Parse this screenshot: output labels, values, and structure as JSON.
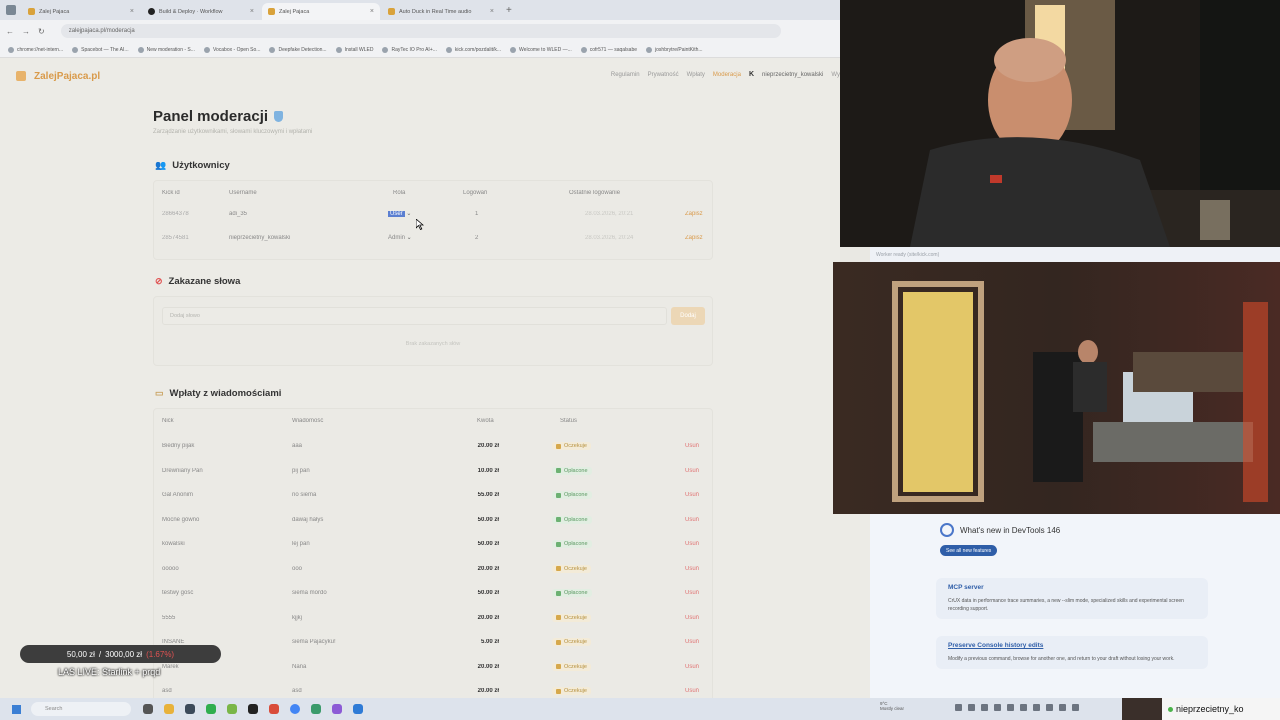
{
  "browser": {
    "tabs": [
      {
        "label": "Zalej Pajaca",
        "active": false
      },
      {
        "label": "Build & Deploy · Workflow",
        "active": false
      },
      {
        "label": "Zalej Pajaca",
        "active": true
      },
      {
        "label": "Auto Duck in Real Time audio",
        "active": false
      }
    ],
    "new_tab": "+",
    "url": "zalejpajaca.pl/moderacja",
    "bookmarks": [
      "chrome://net-intern...",
      "Spacebot — The AI...",
      "New moderation - S...",
      "Vocabox - Open So...",
      "Deepfake Detection...",
      "Install WLED",
      "RayTec IO Pro AI+...",
      "kick.com/pozdalit/k...",
      "Welcome to WLED —...",
      "cofr571 — saqalsabe",
      "joshbrytre/PaintKith..."
    ]
  },
  "site": {
    "logo": "ZalejPajaca.pl",
    "nav": [
      "Regulamin",
      "Prywatność",
      "Wpłaty",
      "Moderacja"
    ],
    "kick_k": "K",
    "user": "nieprzecietny_kowalski",
    "more": "Wy"
  },
  "page": {
    "title": "Panel moderacji",
    "subtitle": "Zarządzanie użytkownikami, słowami kluczowymi i wpłatami"
  },
  "users": {
    "title": "Użytkownicy",
    "columns": [
      "Kick id",
      "Username",
      "Rola",
      "Logowań",
      "Ostatnie logowanie"
    ],
    "rows": [
      {
        "kick_id": "28664378",
        "username": "adi_35",
        "role": "User",
        "logins": "1",
        "last": "28.03.2026, 20:21",
        "save": "Zapisz"
      },
      {
        "kick_id": "28574581",
        "username": "nieprzecietny_kowalski",
        "role": "Admin",
        "logins": "2",
        "last": "28.03.2026, 20:24",
        "save": "Zapisz"
      }
    ]
  },
  "banned": {
    "title": "Zakazane słowa",
    "placeholder": "Dodaj słowo",
    "add": "Dodaj",
    "empty": "Brak zakazanych słów"
  },
  "payments": {
    "title": "Wpłaty z wiadomościami",
    "columns": [
      "Nick",
      "Wiadomość",
      "Kwota",
      "Status"
    ],
    "rows": [
      {
        "nick": "Biedny pijak",
        "msg": "aaa",
        "amount": "20.00 zł",
        "status": "Oczekuje",
        "kind": "pend",
        "del": "Usuń"
      },
      {
        "nick": "Drewniany Pan",
        "msg": "pij pan",
        "amount": "10.00 zł",
        "status": "Opłacone",
        "kind": "paid",
        "del": "Usuń"
      },
      {
        "nick": "Gal Anonim",
        "msg": "no siema",
        "amount": "55.00 zł",
        "status": "Opłacone",
        "kind": "paid",
        "del": "Usuń"
      },
      {
        "nick": "Mocne gówno",
        "msg": "dawaj hałys",
        "amount": "50.00 zł",
        "status": "Opłacone",
        "kind": "paid",
        "del": "Usuń"
      },
      {
        "nick": "kowalski",
        "msg": "lej pan",
        "amount": "50.00 zł",
        "status": "Opłacone",
        "kind": "paid",
        "del": "Usuń"
      },
      {
        "nick": "ooooo",
        "msg": "ooo",
        "amount": "20.00 zł",
        "status": "Oczekuje",
        "kind": "pend",
        "del": "Usuń"
      },
      {
        "nick": "testwy gość",
        "msg": "siema mordo",
        "amount": "50.00 zł",
        "status": "Opłacone",
        "kind": "paid",
        "del": "Usuń"
      },
      {
        "nick": "5555",
        "msg": "kjjkj",
        "amount": "20.00 zł",
        "status": "Oczekuje",
        "kind": "pend",
        "del": "Usuń"
      },
      {
        "nick": "INSANE",
        "msg": "siema Pajacyku!",
        "amount": "5.00 zł",
        "status": "Oczekuje",
        "kind": "pend",
        "del": "Usuń"
      },
      {
        "nick": "Marek",
        "msg": "Nana",
        "amount": "20.00 zł",
        "status": "Oczekuje",
        "kind": "pend",
        "del": "Usuń"
      },
      {
        "nick": "asd",
        "msg": "asd",
        "amount": "20.00 zł",
        "status": "Oczekuje",
        "kind": "pend",
        "del": "Usuń"
      }
    ]
  },
  "devtools": {
    "topbar": "Worker ready (site/kick.com)",
    "heading": "What's new in DevTools 146",
    "see_all": "See all new features",
    "cards": [
      {
        "title": "MCP server",
        "body": "CrUX data in performance trace summaries, a new --slim mode, specialized skills and experimental screen recording support."
      },
      {
        "title": "Preserve Console history edits",
        "body": "Modify a previous command, browse for another one, and return to your draft without losing your work."
      }
    ]
  },
  "overlay": {
    "donate_current": "50,00 zł",
    "donate_sep": "/",
    "donate_goal": "3000,00 zł",
    "donate_pct": "(1.67%)",
    "live_title": "LAS LIVE: Starlink + prqd",
    "chat_user": "nieprzecietny_ko"
  },
  "taskbar": {
    "search": "Search",
    "weather_temp": "9°C",
    "weather_desc": "Mostly clear"
  },
  "colors": {
    "accent": "#d99a4a",
    "paid": "#5c9a63",
    "pending": "#b6913f",
    "delete": "#e07474",
    "devtools_blue": "#2f5ea8"
  }
}
